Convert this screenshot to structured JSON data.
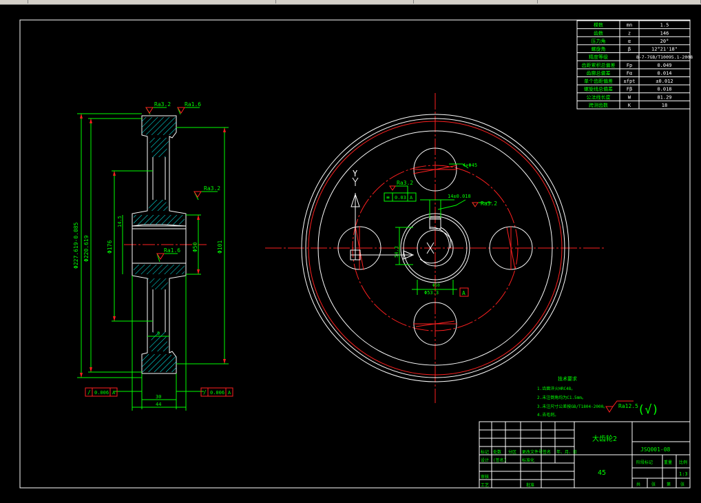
{
  "colors": {
    "background": "#000000",
    "lines": "#ffffff",
    "center": "#ff2020",
    "dimension": "#00ff00",
    "hatch": "#00ffff",
    "tolerance": "#ff2020",
    "text": "#ffffff"
  },
  "params_table": [
    [
      "模数",
      "mn",
      "1.5"
    ],
    [
      "齿数",
      "z",
      "146"
    ],
    [
      "压力角",
      "α",
      "20°"
    ],
    [
      "螺旋角",
      "β",
      "12°21'18\""
    ],
    [
      "精度等级",
      "",
      "8-7-7GB/T10095.1-2008"
    ],
    [
      "齿距累积总偏差",
      "Fp",
      "0.049"
    ],
    [
      "齿廓总偏差",
      "Fα",
      "0.014"
    ],
    [
      "单个齿距偏差",
      "±fpt",
      "±0.012"
    ],
    [
      "螺旋线总偏差",
      "Fβ",
      "0.018"
    ],
    [
      "公法线长度",
      "W",
      "81.29"
    ],
    [
      "跨测齿数",
      "K",
      "18"
    ]
  ],
  "dims_section": {
    "outer_dia": "Φ227.619-0.085",
    "root_dia": "Φ220.619",
    "web_dia": "Φ176",
    "hub_dia": "Φ101",
    "bore_dia": "Φ50",
    "keyway": "14.5",
    "web_thk": "9",
    "face_width": "30",
    "hub_length": "44",
    "rough_top": "Ra3.2",
    "rough_top2": "Ra1.6",
    "rough_mid": "Ra3.2",
    "rough_bore": "Ra1.6",
    "tol_left": [
      "/",
      "0.006",
      "A"
    ],
    "tol_right": [
      "/",
      "0.006",
      "A"
    ]
  },
  "dims_front": {
    "axis_y": "Y",
    "hole_dim": "4×Φ45",
    "key_width": "14±0.018",
    "rough_key": "Ra3.2",
    "rough_hub": "Ra3.2",
    "sym_tol": [
      "≡",
      "0.03",
      "A"
    ],
    "hub_label": "Φ53.3",
    "datum_label": "Φ50",
    "keyslot": "54.3",
    "datum_box": "A"
  },
  "notes": {
    "title": "技术要求",
    "lines": [
      "1.齿面淬火HRC48。",
      "2.未注倒角均为C1.5mm。",
      "3.未注尺寸公差按GB/T1804-2000。",
      "4.去毛刺。"
    ]
  },
  "rough_other": "Ra12.5",
  "rough_other_symbol": "(√)",
  "title_block": {
    "part_name": "大齿轮2",
    "drawing_no": "JSQ001-08",
    "material": "45",
    "scale": "1:3",
    "headers": [
      "标记",
      "处数",
      "分区",
      "更改文件号",
      "签名",
      "年、月、日"
    ],
    "row_design": [
      "设计",
      "(签名)",
      "",
      "标准化",
      "",
      ""
    ],
    "row_check": [
      "审核",
      ""
    ],
    "row_process": [
      "工艺",
      "",
      "",
      "批准",
      "",
      ""
    ],
    "stage_labels": [
      "阶段标记",
      "重量",
      "比例"
    ],
    "sheet_labels": [
      "共",
      "张",
      "第",
      "张"
    ]
  }
}
